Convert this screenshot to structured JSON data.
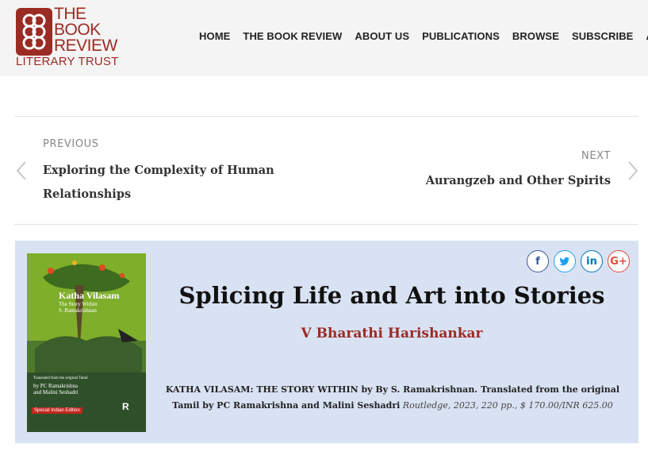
{
  "site": {
    "logo_line1": "THE",
    "logo_line2": "BOOK",
    "logo_line3": "REVIEW",
    "logo_sub": "LITERARY TRUST",
    "brand_color": "#9b2c24"
  },
  "nav": {
    "items": [
      "HOME",
      "THE BOOK REVIEW",
      "ABOUT US",
      "PUBLICATIONS",
      "BROWSE",
      "SUBSCRIBE",
      "A"
    ]
  },
  "post_nav": {
    "prev_label": "PREVIOUS",
    "prev_title": "Exploring the Complexity of Human Relationships",
    "next_label": "NEXT",
    "next_title": "Aurangzeb and Other Spirits"
  },
  "article": {
    "title": "Splicing Life and Art into Stories",
    "author": "V Bharathi Harishankar",
    "book_info_bold": "KATHA VILASAM: THE STORY WITHIN by By S. Ramakrishnan. Translated from the original Tamil by PC Ramakrishna and Malini Seshadri",
    "book_info_pub": "Routledge, 2023, 220 pp., $ 170.00/INR 625.00",
    "card_bg": "#d9e2f3"
  },
  "cover": {
    "title": "Katha Vilasam",
    "subtitle": "The Story Within",
    "author": "S. Ramakrishnan",
    "translated_line": "Translated from the original Tamil",
    "translators_line1": "by PC Ramakrishna",
    "translators_line2": "and Malini Seshadri",
    "badge": "Special Indian Edition",
    "publisher_mark": "R"
  },
  "share": {
    "facebook": "f",
    "twitter": "t",
    "linkedin": "in",
    "googleplus": "G+"
  }
}
